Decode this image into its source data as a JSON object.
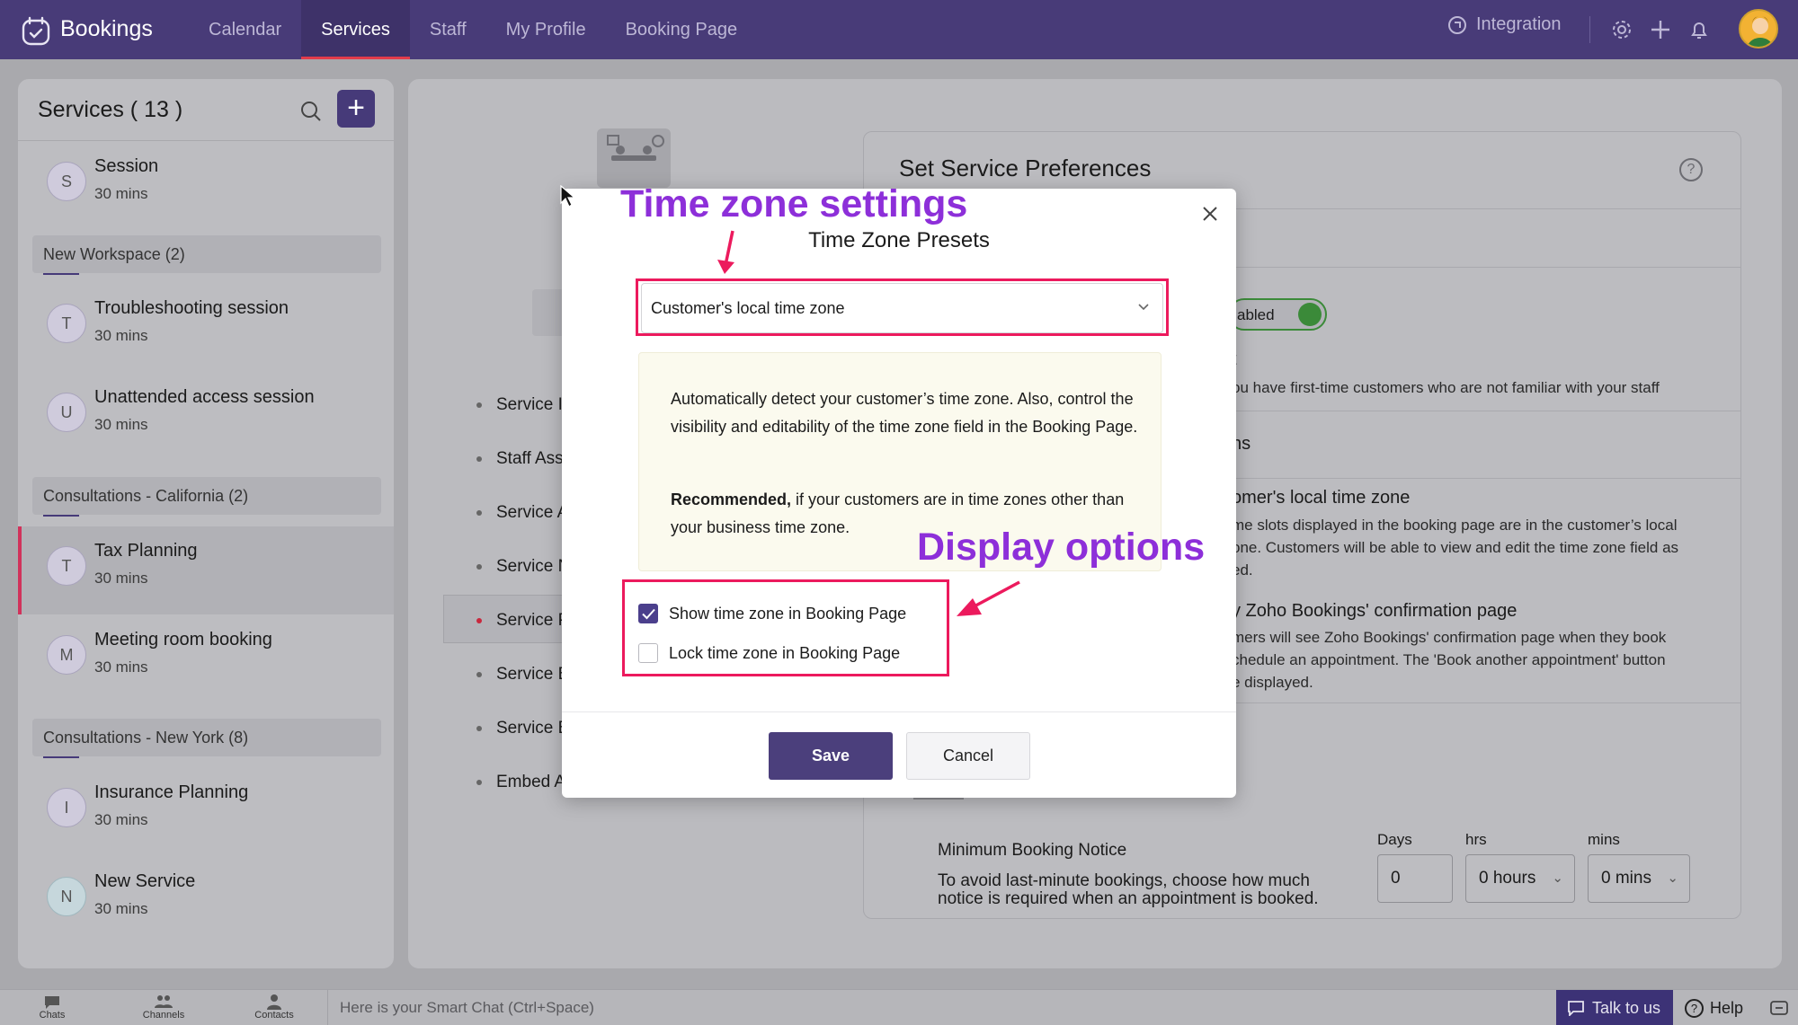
{
  "app": {
    "brand": "Bookings"
  },
  "nav": {
    "tabs": [
      {
        "label": "Calendar"
      },
      {
        "label": "Services"
      },
      {
        "label": "Staff"
      },
      {
        "label": "My Profile"
      },
      {
        "label": "Booking Page"
      }
    ],
    "active_tab": "Services",
    "integration_label": "Integration"
  },
  "sidebar": {
    "title": "Services ( 13 )",
    "services_top": [
      {
        "avatar": "S",
        "name": "Session",
        "duration": "30 mins"
      }
    ],
    "groups": [
      {
        "name": "New Workspace (2)",
        "services": [
          {
            "avatar": "T",
            "name": "Troubleshooting session",
            "duration": "30 mins"
          },
          {
            "avatar": "U",
            "name": "Unattended access session",
            "duration": "30 mins"
          }
        ]
      },
      {
        "name": "Consultations - California (2)",
        "services": [
          {
            "avatar": "T",
            "name": "Tax Planning",
            "duration": "30 mins",
            "selected": true
          },
          {
            "avatar": "M",
            "name": "Meeting room booking",
            "duration": "30 mins"
          }
        ]
      },
      {
        "name": "Consultations - New York (8)",
        "services": [
          {
            "avatar": "I",
            "name": "Insurance Planning",
            "duration": "30 mins"
          },
          {
            "avatar": "N",
            "name": "New Service",
            "duration": "30 mins"
          }
        ]
      }
    ]
  },
  "settings_menu": {
    "items": [
      {
        "label": "Service In"
      },
      {
        "label": "Staff Assi"
      },
      {
        "label": "Service A"
      },
      {
        "label": "Service N"
      },
      {
        "label": "Service P",
        "active": true
      },
      {
        "label": "Service B"
      },
      {
        "label": "Service B"
      },
      {
        "label": "Embed A"
      }
    ]
  },
  "preferences": {
    "title": "Set Service Preferences",
    "toggle_label": "abled",
    "partial_lines": {
      "line1": "t",
      "line2": "ou have first-time customers who are not familiar with your staff",
      "line3": "ns",
      "tz_heading": "omer's local time zone",
      "tz_desc1": "me slots displayed in the booking page are in the customer’s local",
      "tz_desc2": "one. Customers will be able to view and edit the time zone field as",
      "tz_desc3": "ed.",
      "conf_heading": "y Zoho Bookings' confirmation page",
      "conf_desc1": "mers will see Zoho Bookings' confirmation page when they book",
      "conf_desc2": "chedule an appointment. The 'Book another appointment' button",
      "conf_desc3": "e displayed."
    },
    "min_notice": {
      "title": "Minimum Booking Notice",
      "description1": "To avoid last-minute bookings, choose how much",
      "description2": "notice is required when an appointment is booked.",
      "days_label": "Days",
      "days_value": "0",
      "hrs_label": "hrs",
      "hrs_value": "0 hours",
      "mins_label": "mins",
      "mins_value": "0 mins"
    }
  },
  "modal": {
    "title": "Time Zone Presets",
    "select_value": "Customer's local time zone",
    "info_p1": "Automatically detect your customer’s time zone. Also, control the visibility and editability of the time zone field in the Booking Page.",
    "info_p2_bold": "Recommended,",
    "info_p2_rest": " if your customers are in time zones other than your business time zone.",
    "checkboxes": [
      {
        "label": "Show time zone in Booking Page",
        "checked": true
      },
      {
        "label": "Lock time zone in Booking Page",
        "checked": false
      }
    ],
    "save_label": "Save",
    "cancel_label": "Cancel"
  },
  "annotations": {
    "time_zone_settings": "Time zone settings",
    "display_options": "Display options",
    "highlight_color": "#ec1a5d",
    "text_color": "#8d2fd9"
  },
  "bottom_bar": {
    "chats": "Chats",
    "channels": "Channels",
    "contacts": "Contacts",
    "smart_chat_placeholder": "Here is your Smart Chat (Ctrl+Space)",
    "talk_label": "Talk to us",
    "help_label": "Help"
  },
  "colors": {
    "nav_bg": "#483b78",
    "accent": "#4b3f7c",
    "active_indicator": "#e23c4b"
  }
}
